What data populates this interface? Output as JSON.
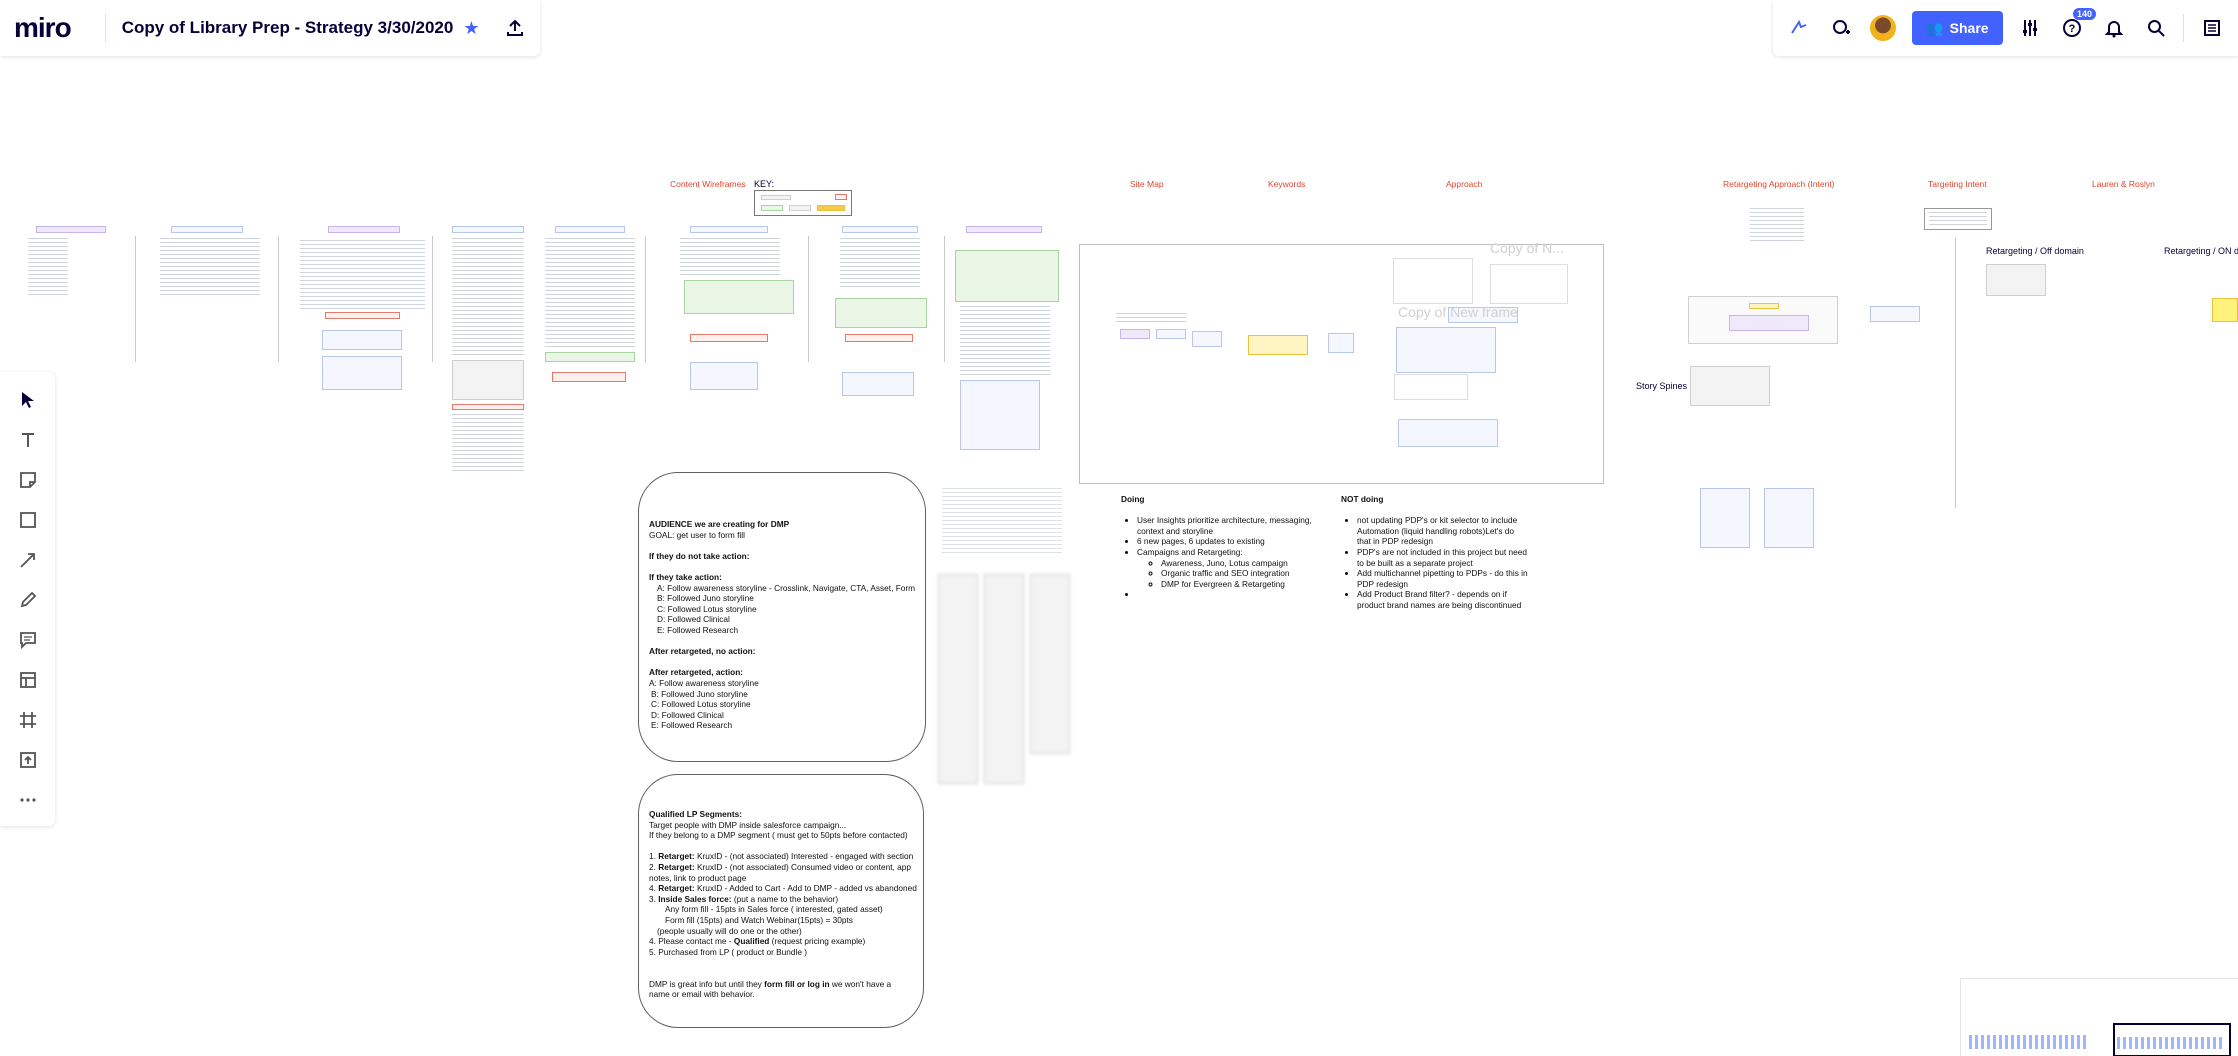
{
  "app": {
    "logo": "miro",
    "board_title": "Copy of Library Prep - Strategy 3/30/2020"
  },
  "topbar": {
    "share_label": "Share",
    "notifications_count": "140"
  },
  "toolbar": {
    "items": [
      "select",
      "text",
      "sticky-note",
      "shape",
      "connection-line",
      "pen",
      "comment",
      "templates",
      "frame",
      "upload",
      "more"
    ]
  },
  "canvas": {
    "section_labels": {
      "content_wireframes": "Content Wireframes",
      "key": "KEY:",
      "site_map": "Site Map",
      "keywords": "Keywords",
      "approach": "Approach",
      "retargeting_approach": "Retargeting Approach (Intent)",
      "targeting_intent": "Targeting Intent",
      "lauren_roslyn": "Lauren & Roslyn"
    },
    "frame_ghosts": [
      "Copy of N...",
      "Copy of New frame"
    ],
    "side_labels": {
      "retargeting_off": "Retargeting / Off domain",
      "retargeting_on": "Retargeting / ON do",
      "story_spines": "Story Spines"
    },
    "audience_card": {
      "title": "AUDIENCE we are creating for DMP",
      "goal": "GOAL: get user to form fill",
      "no_action_heading": "If they do not take action:",
      "take_action_heading": "If they take action:",
      "take_action_items": [
        "A: Follow awareness storyline - Crosslink, Navigate, CTA, Asset, Form",
        "B: Followed Juno storyline",
        "C: Followed Lotus storyline",
        "D: Followed Clinical",
        "E: Followed Research"
      ],
      "retargeted_no_action": "After retargeted, no action:",
      "retargeted_action": "After retargeted, action:",
      "retargeted_items": [
        "A: Follow awareness storyline",
        " B: Followed Juno storyline",
        " C: Followed Lotus storyline",
        " D: Followed Clinical",
        " E: Followed Research"
      ]
    },
    "qualified_card": {
      "title": "Qualified LP Segments:",
      "line1": "Target people with DMP inside salesforce campaign...",
      "line2": "If they belong to a DMP segment ( must get to 50pts before contacted)",
      "item1_bold": "Retarget:",
      "item1_text": " KruxID - (not associated) Interested - engaged with section",
      "item2_bold": "Retarget:",
      "item2_text": " KruxID - (not associated) Consumed video or content, app",
      "item2_cont": "notes, link to product page",
      "item3_bold": "Retarget:",
      "item3_text": " KruxID - Added to Cart - Add to DMP - added vs abandoned",
      "item4_bold": "Inside Sales force:",
      "item4_text": " (put a name to the behavior)",
      "item4_sub1": "Any form fill - 15pts in Sales force ( interested, gated asset)",
      "item4_sub2": "Form fill (15pts) and Watch Webinar(15pts) = 30pts",
      "item4_sub3": "(people usually will do one or the other)",
      "item5_pre": "Please contact me - ",
      "item5_bold": "Qualified",
      "item5_post": " (request pricing example)",
      "item6": "Purchased from LP ( product or Bundle )",
      "footer_pre": "DMP is great info but until they ",
      "footer_bold": "form fill or log in",
      "footer_post": " we won't have a",
      "footer_cont": "name or email with behavior."
    },
    "doing": {
      "heading": "Doing",
      "items": [
        "User Insights prioritize architecture, messaging,",
        "context and storyline",
        "6 new pages, 6 updates to existing",
        "Campaigns and Retargeting:"
      ],
      "sub_items": [
        "Awareness, Juno, Lotus campaign",
        "Organic traffic and SEO integration",
        "DMP for Evergreen  & Retargeting"
      ]
    },
    "not_doing": {
      "heading": "NOT doing",
      "items": [
        "not updating PDP's or kit selector to include",
        "Automation (liquid handling robots)Let's do",
        "that in PDP redesign",
        "PDP's are not included in this project but need",
        "to be built as a separate project",
        "Add multichannel pipetting to PDPs - do this in",
        "PDP redesign",
        "Add Product Brand filter? - depends on if",
        "product brand names are being discontinued"
      ]
    }
  }
}
